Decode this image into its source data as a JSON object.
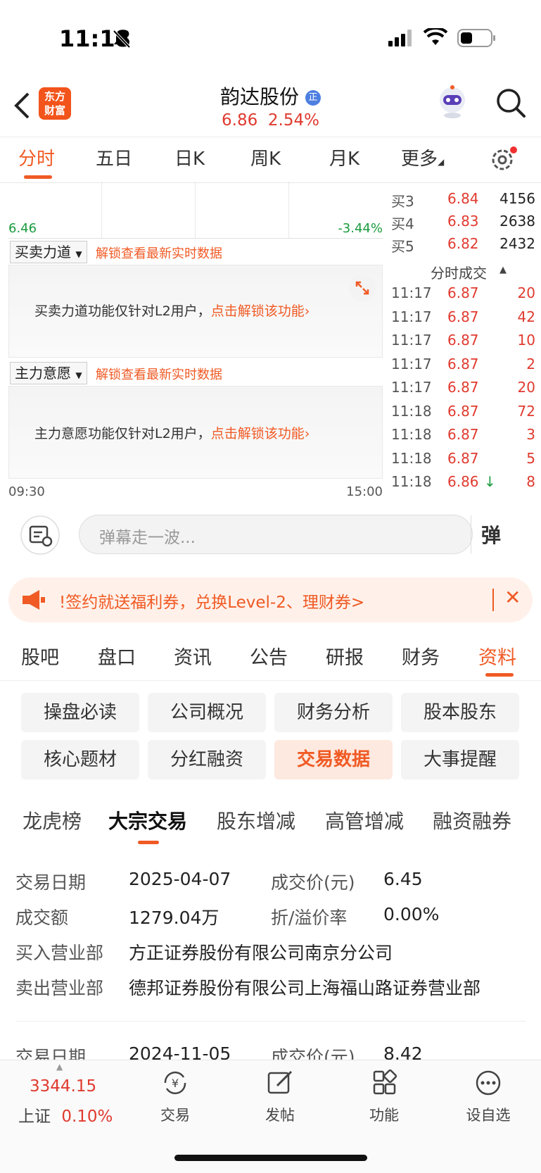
{
  "status_bar": {
    "time": "11:18"
  },
  "header": {
    "logo_text_line1": "东方",
    "logo_text_line2": "财富",
    "stock_name": "韵达股份",
    "price": "6.86",
    "change_pct": "2.54%",
    "badge": "正",
    "colors": {
      "up": "#e03a2f",
      "accent": "#f05a24"
    }
  },
  "chart_tabs": [
    "分时",
    "五日",
    "日K",
    "周K",
    "月K",
    "更多"
  ],
  "chart": {
    "low_price_label": "6.46",
    "low_pct_label": "-3.44%",
    "time_start": "09:30",
    "time_end": "15:00",
    "panels": [
      {
        "select": "买卖力道",
        "unlock": "解锁查看最新实时数据",
        "message": "买卖力道功能仅针对L2用户，",
        "link": "点击解锁该功能"
      },
      {
        "select": "主力意愿",
        "unlock": "解锁查看最新实时数据",
        "message": "主力意愿功能仅针对L2用户，",
        "link": "点击解锁该功能"
      }
    ]
  },
  "order_book": {
    "bids": [
      {
        "label": "买3",
        "price": "6.84",
        "volume": "4156"
      },
      {
        "label": "买4",
        "price": "6.83",
        "volume": "2638"
      },
      {
        "label": "买5",
        "price": "6.82",
        "volume": "2432"
      }
    ],
    "trades_title": "分时成交",
    "trades": [
      {
        "time": "11:17",
        "price": "6.87",
        "volume": "20"
      },
      {
        "time": "11:17",
        "price": "6.87",
        "volume": "42"
      },
      {
        "time": "11:17",
        "price": "6.87",
        "volume": "10"
      },
      {
        "time": "11:17",
        "price": "6.87",
        "volume": "2"
      },
      {
        "time": "11:17",
        "price": "6.87",
        "volume": "20"
      },
      {
        "time": "11:18",
        "price": "6.87",
        "volume": "72"
      },
      {
        "time": "11:18",
        "price": "6.87",
        "volume": "3"
      },
      {
        "time": "11:18",
        "price": "6.87",
        "volume": "5"
      },
      {
        "time": "11:18",
        "price": "6.86",
        "volume": "8"
      }
    ]
  },
  "danmu": {
    "placeholder": "弹幕走一波...",
    "send_label": "弹"
  },
  "banner": {
    "text": "!签约就送福利券，兑换Level-2、理财券>"
  },
  "section_tabs": [
    "股吧",
    "盘口",
    "资讯",
    "公告",
    "研报",
    "财务",
    "资料"
  ],
  "info_buttons": [
    "操盘必读",
    "公司概况",
    "财务分析",
    "股本股东",
    "核心题材",
    "分红融资",
    "交易数据",
    "大事提醒"
  ],
  "sub_tabs": [
    "龙虎榜",
    "大宗交易",
    "股东增减",
    "高管增减",
    "融资融券"
  ],
  "block_trades": [
    {
      "date_label": "交易日期",
      "date": "2025-04-07",
      "price_label": "成交价(元)",
      "price": "6.45",
      "amount_label": "成交额",
      "amount": "1279.04万",
      "premium_label": "折/溢价率",
      "premium": "0.00%",
      "buyer_label": "买入营业部",
      "buyer": "方正证券股份有限公司南京分公司",
      "seller_label": "卖出营业部",
      "seller": "德邦证券股份有限公司上海福山路证券营业部"
    },
    {
      "date_label": "交易日期",
      "date": "2024-11-05",
      "price_label": "成交价(元)",
      "price": "8.42"
    }
  ],
  "bottom_bar": {
    "index_value": "3344.15",
    "index_name": "上证",
    "index_change": "0.10%",
    "items": [
      "交易",
      "发帖",
      "功能",
      "设自选"
    ]
  }
}
